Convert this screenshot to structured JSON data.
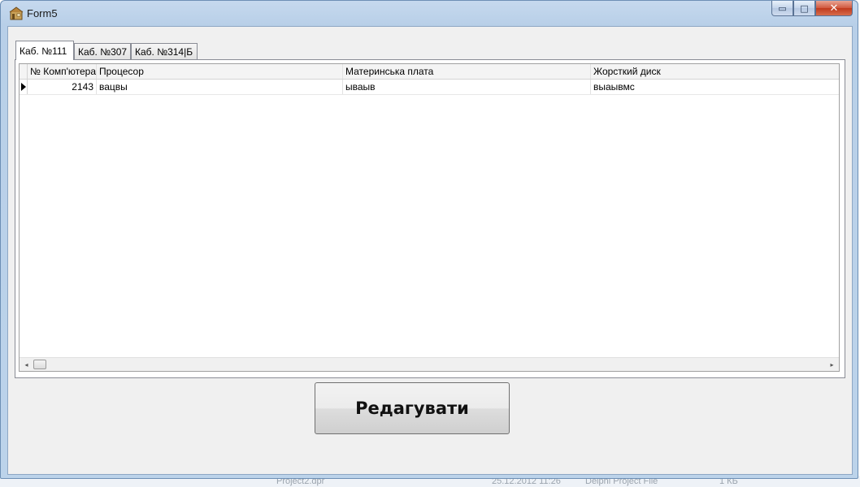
{
  "window": {
    "title": "Form5",
    "minimize_glyph": "▭",
    "maximize_glyph": "□",
    "close_glyph": "✕"
  },
  "tabs": [
    {
      "label": "Каб. №111",
      "active": true
    },
    {
      "label": "Каб. №307",
      "active": false
    },
    {
      "label": "Каб. №314|Б",
      "active": false
    }
  ],
  "grid": {
    "columns": [
      "№ Комп'ютера",
      "Процесор",
      "Материнська плата",
      "Жорсткий диск"
    ],
    "rows": [
      {
        "number": "2143",
        "processor": "вацвы",
        "motherboard": "ываыв",
        "hdd": "выаывмс"
      }
    ]
  },
  "scrollbar": {
    "left_arrow": "◂",
    "right_arrow": "▸"
  },
  "actions": {
    "edit_label": "Редагувати"
  },
  "background": {
    "file_name": "Project2.dpr",
    "file_date": "25.12.2012 11:26",
    "file_type": "Delphi Project File",
    "file_size": "1 КБ"
  }
}
